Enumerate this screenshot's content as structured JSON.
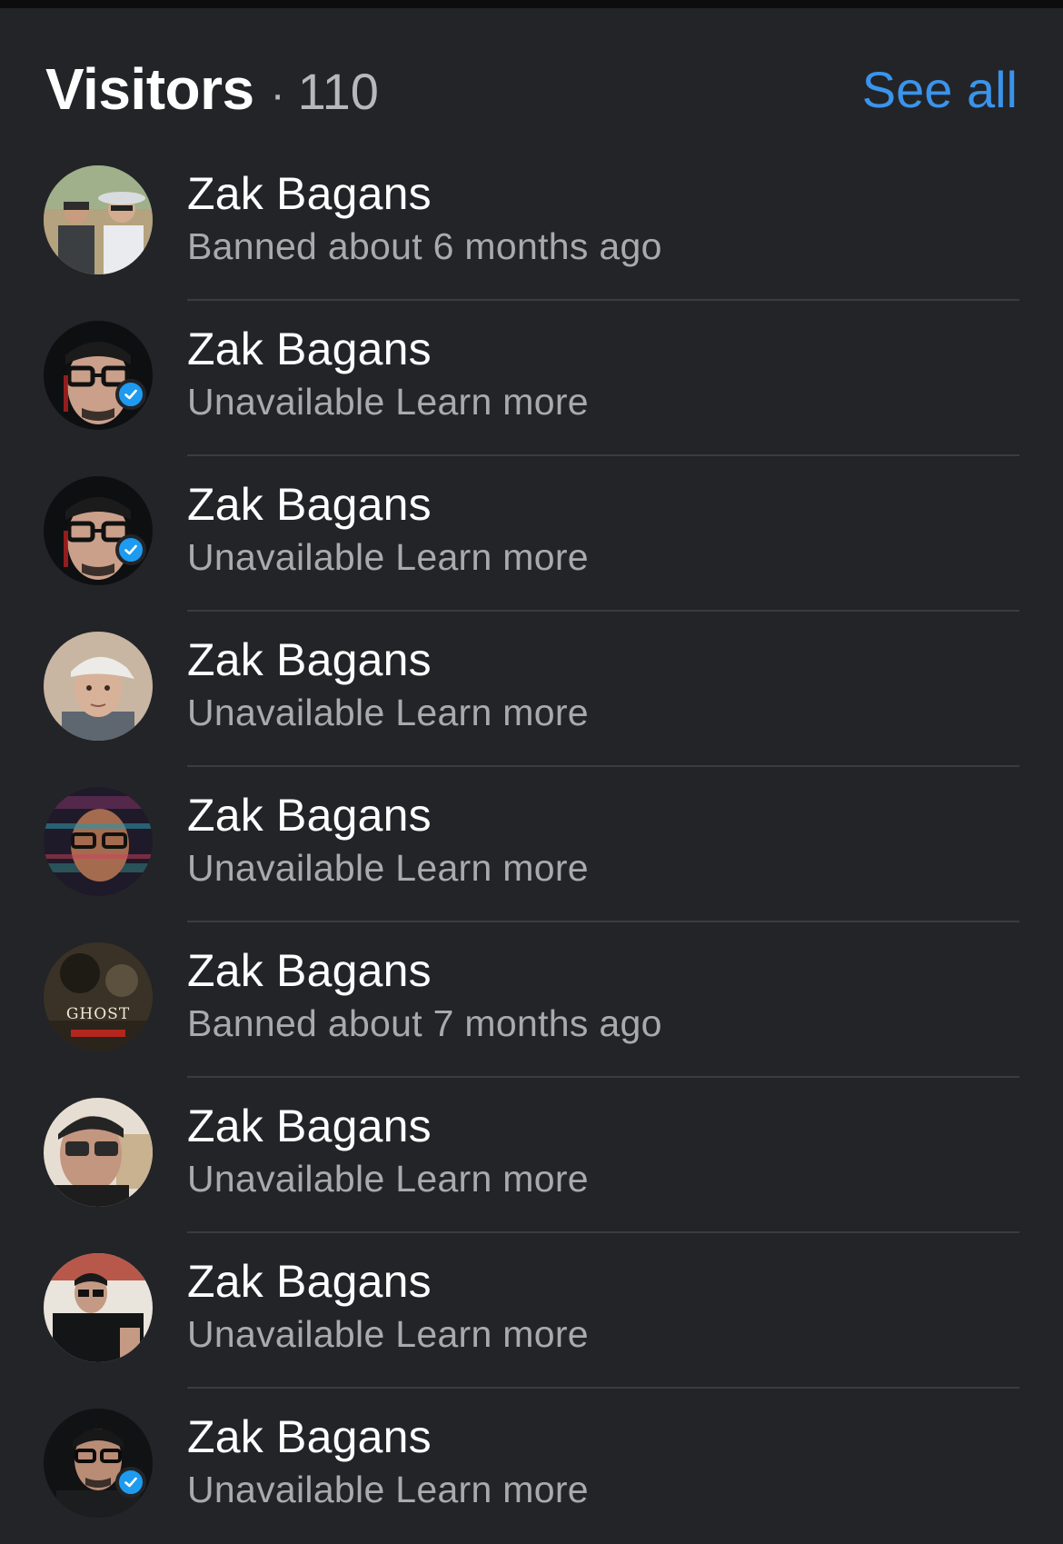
{
  "header": {
    "title": "Visitors",
    "separator": "·",
    "count": "110",
    "see_all_label": "See all",
    "accent_color": "#3a94ec"
  },
  "visitors": [
    {
      "name": "Zak Bagans",
      "status": "Banned about 6 months ago",
      "verified": false,
      "avatar": "outdoor-duo-photo"
    },
    {
      "name": "Zak Bagans",
      "status": "Unavailable Learn more",
      "verified": true,
      "avatar": "glasses-portrait"
    },
    {
      "name": "Zak Bagans",
      "status": "Unavailable Learn more",
      "verified": true,
      "avatar": "glasses-portrait"
    },
    {
      "name": "Zak Bagans",
      "status": "Unavailable Learn more",
      "verified": false,
      "avatar": "cap-portrait"
    },
    {
      "name": "Zak Bagans",
      "status": "Unavailable Learn more",
      "verified": false,
      "avatar": "glitch-portrait"
    },
    {
      "name": "Zak Bagans",
      "status": "Banned about 7 months ago",
      "verified": false,
      "avatar": "ghost-adventures-poster",
      "avatar_text": "GHOST"
    },
    {
      "name": "Zak Bagans",
      "status": "Unavailable Learn more",
      "verified": false,
      "avatar": "selfie-portrait"
    },
    {
      "name": "Zak Bagans",
      "status": "Unavailable Learn more",
      "verified": false,
      "avatar": "black-shirt-portrait"
    },
    {
      "name": "Zak Bagans",
      "status": "Unavailable Learn more",
      "verified": true,
      "avatar": "dark-portrait"
    }
  ]
}
